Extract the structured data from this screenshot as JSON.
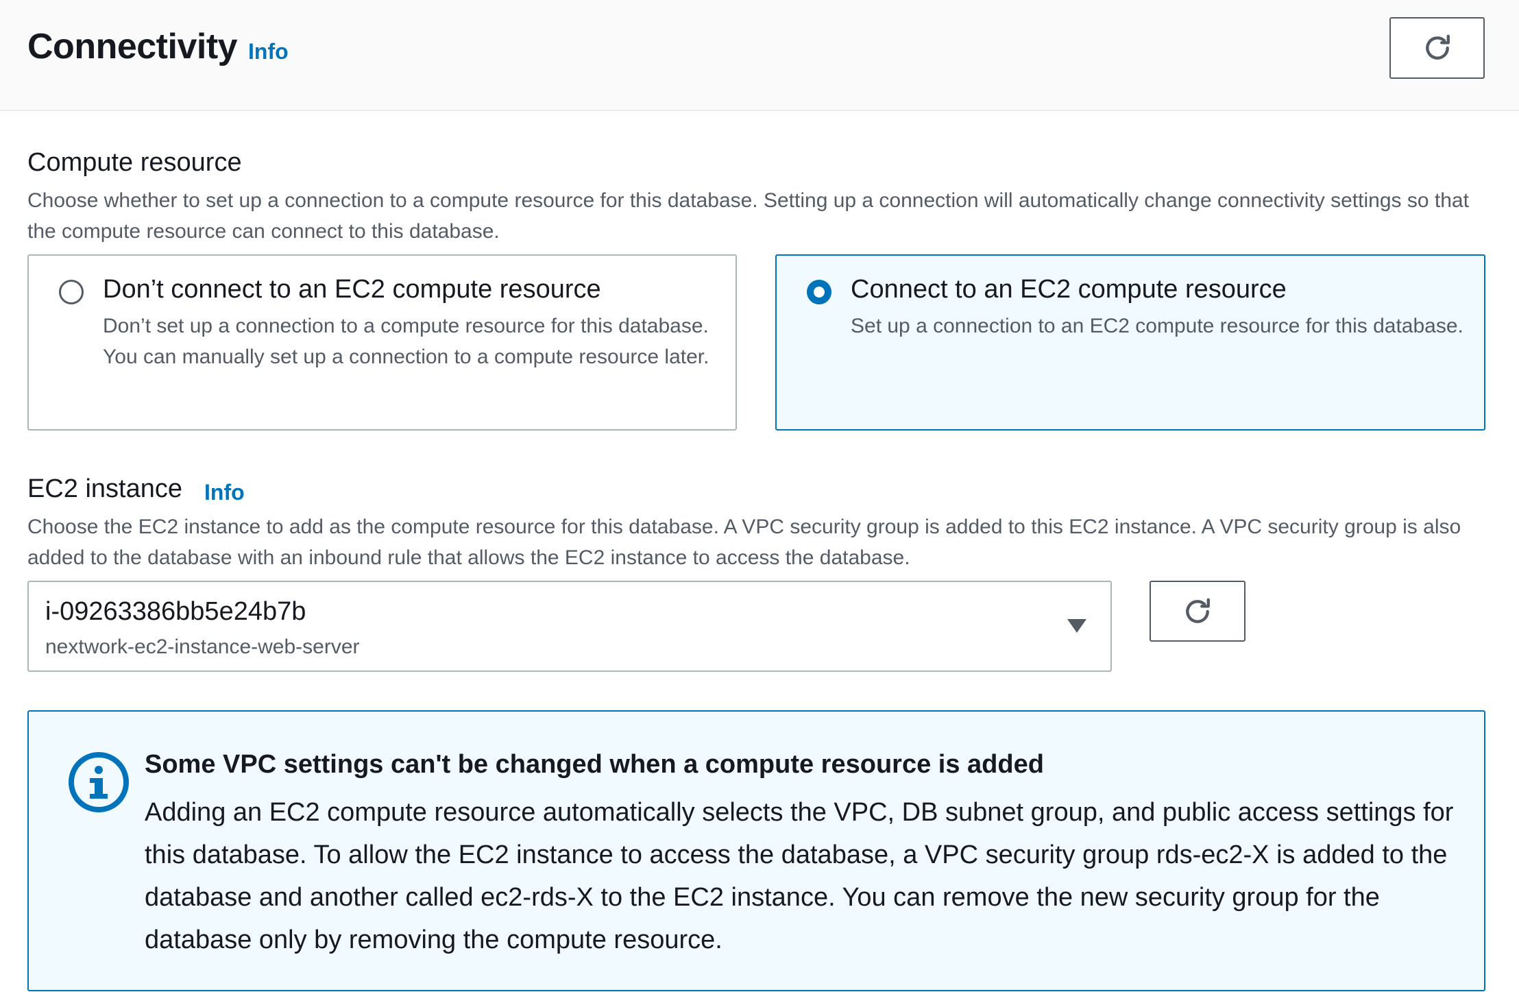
{
  "header": {
    "title": "Connectivity",
    "info_label": "Info"
  },
  "compute_resource": {
    "label": "Compute resource",
    "description": "Choose whether to set up a connection to a compute resource for this database. Setting up a connection will automatically change connectivity settings so that the compute resource can connect to this database.",
    "options": [
      {
        "title": "Don’t connect to an EC2 compute resource",
        "description": "Don’t set up a connection to a compute resource for this database. You can manually set up a connection to a compute resource later.",
        "selected": false
      },
      {
        "title": "Connect to an EC2 compute resource",
        "description": "Set up a connection to an EC2 compute resource for this database.",
        "selected": true
      }
    ]
  },
  "ec2_instance": {
    "label": "EC2 instance",
    "info_label": "Info",
    "description": "Choose the EC2 instance to add as the compute resource for this database. A VPC security group is added to this EC2 instance. A VPC security group is also added to the database with an inbound rule that allows the EC2 instance to access the database.",
    "selected_value": "i-09263386bb5e24b7b",
    "selected_name": "nextwork-ec2-instance-web-server"
  },
  "alert": {
    "title": "Some VPC settings can't be changed when a compute resource is added",
    "body": "Adding an EC2 compute resource automatically selects the VPC, DB subnet group, and public access settings for this database. To allow the EC2 instance to access the database, a VPC security group rds-ec2-X is added to the database and another called ec2-rds-X to the EC2 instance. You can remove the new security group for the database only by removing the compute resource."
  },
  "colors": {
    "accent": "#0073bb",
    "alert_background": "#f1faff",
    "text_primary": "#16191f",
    "text_secondary": "#545b64"
  },
  "icons": {
    "refresh": "refresh-icon",
    "dropdown": "caret-down-icon",
    "info": "info-circle-icon"
  }
}
